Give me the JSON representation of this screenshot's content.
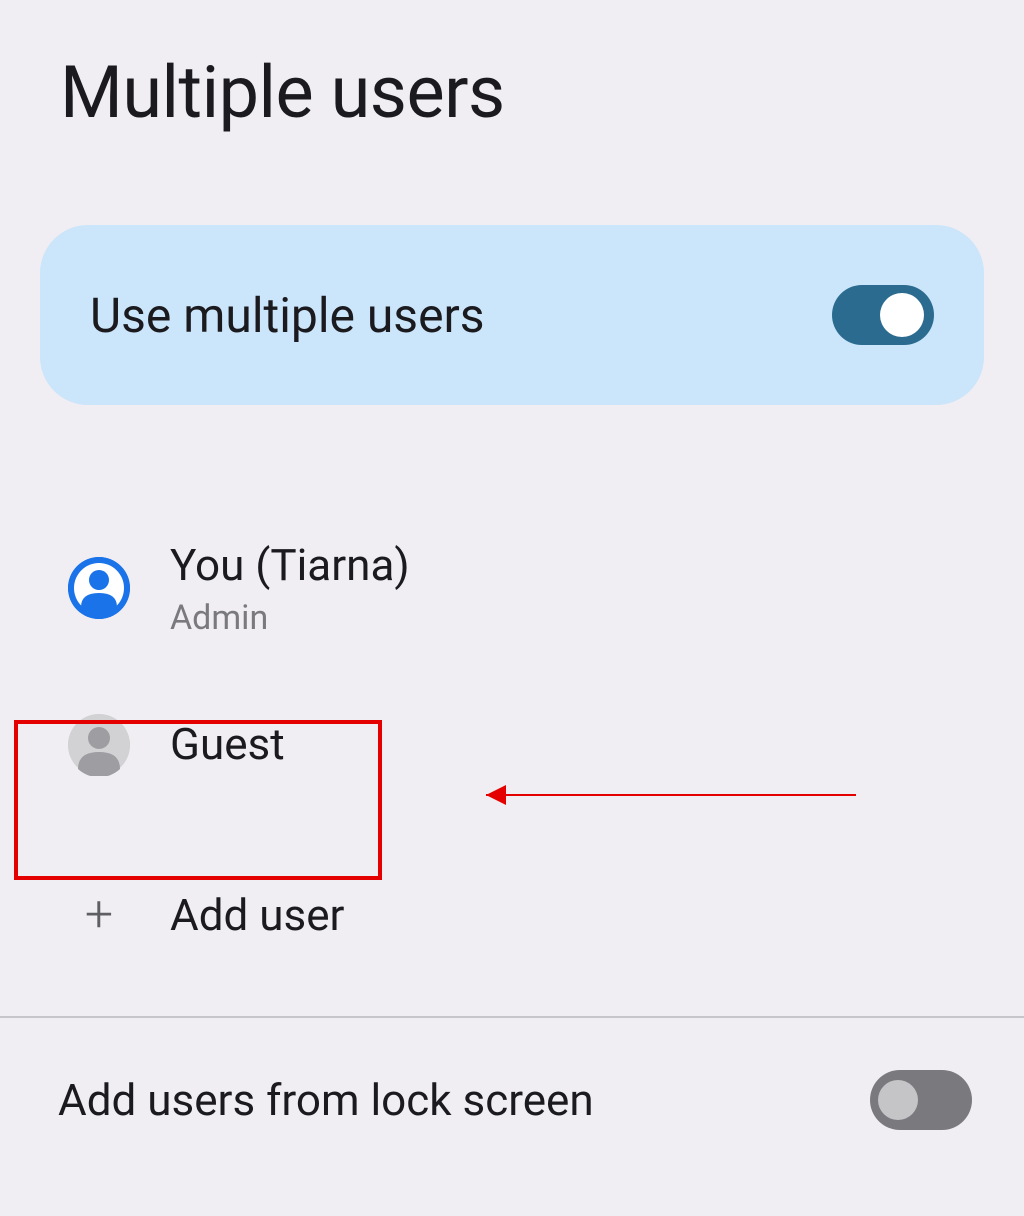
{
  "page": {
    "title": "Multiple users"
  },
  "toggle": {
    "label": "Use multiple users",
    "state": "on"
  },
  "users": {
    "primary": {
      "name": "You (Tiarna)",
      "role": "Admin"
    },
    "guest": {
      "name": "Guest"
    }
  },
  "add_user": {
    "label": "Add user"
  },
  "lock_screen": {
    "label": "Add users from lock screen",
    "state": "off"
  }
}
